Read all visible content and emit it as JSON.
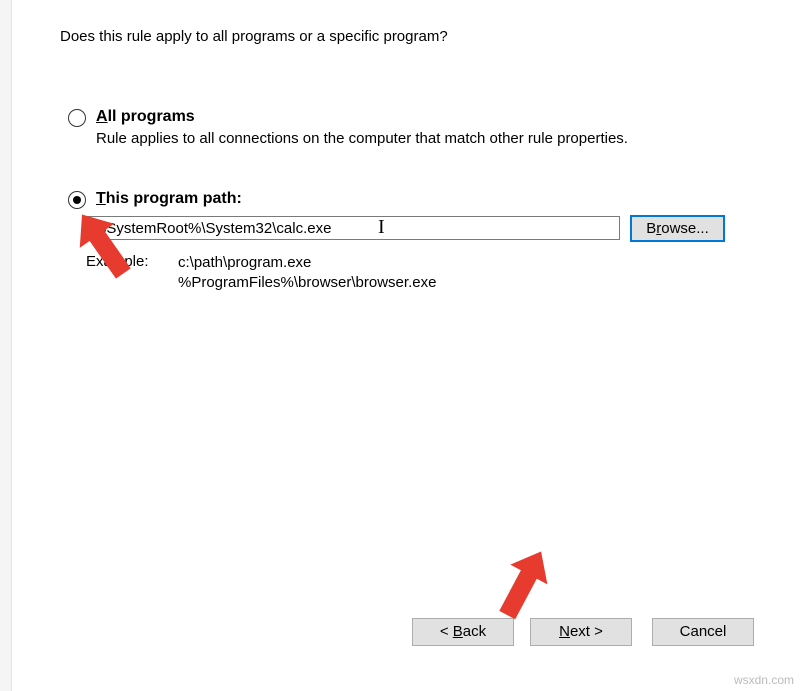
{
  "question": "Does this rule apply to all programs or a specific program?",
  "options": {
    "all": {
      "label_prefix": "A",
      "label_rest": "ll programs",
      "description": "Rule applies to all connections on the computer that match other rule properties.",
      "selected": false
    },
    "path": {
      "label_prefix": "T",
      "label_rest": "his program path:",
      "selected": true
    }
  },
  "path_input": {
    "value": "%SystemRoot%\\System32\\calc.exe"
  },
  "browse": {
    "prefix": "B",
    "underline": "r",
    "rest": "owse..."
  },
  "example": {
    "label": "Example:",
    "line1": "c:\\path\\program.exe",
    "line2": "%ProgramFiles%\\browser\\browser.exe"
  },
  "footer": {
    "back": {
      "prefix": "< ",
      "underline": "B",
      "rest": "ack"
    },
    "next": {
      "underline": "N",
      "rest": "ext >"
    },
    "cancel": "Cancel"
  },
  "watermark": "wsxdn.com"
}
